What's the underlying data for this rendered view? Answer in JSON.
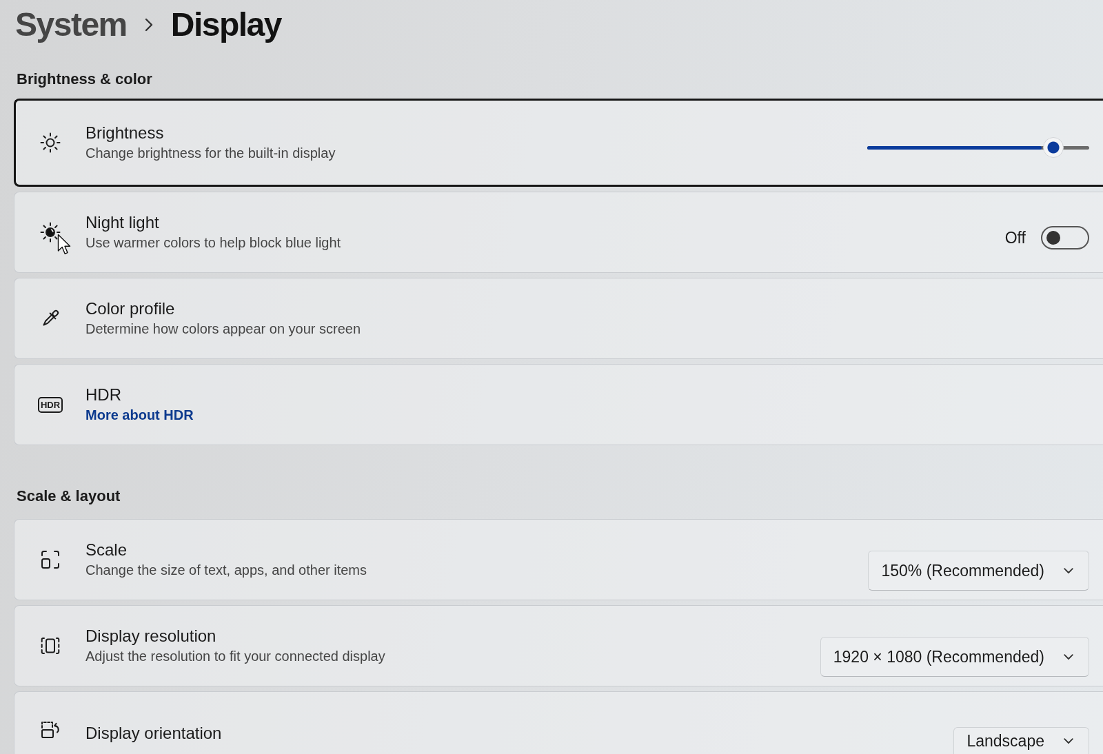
{
  "breadcrumb": [
    {
      "label": "System",
      "current": false
    },
    {
      "label": "Display",
      "current": true
    }
  ],
  "sections": [
    {
      "title": "Brightness & color",
      "items": [
        {
          "kind": "slider",
          "title": "Brightness",
          "subtitle": "Change brightness for the built-in display",
          "focused": true,
          "pointer": false,
          "level": 0.84
        },
        {
          "kind": "toggle",
          "title": "Night light",
          "subtitle": "Use warmer colors to help block blue light",
          "focused": false,
          "pointer": true,
          "on": false,
          "state_label": "Off"
        },
        {
          "kind": "plain",
          "title": "Color profile",
          "subtitle": "Determine how colors appear on your screen",
          "focused": false,
          "pointer": false
        },
        {
          "kind": "link",
          "title": "HDR",
          "icon_text": "HDR",
          "link": "More about HDR",
          "focused": false,
          "pointer": false
        }
      ]
    },
    {
      "title": "Scale & layout",
      "items": [
        {
          "kind": "dropdown",
          "title": "Scale",
          "subtitle": "Change the size of text, apps, and other items",
          "focused": false,
          "pointer": false,
          "value": "150% (Recommended)"
        },
        {
          "kind": "dropdown",
          "title": "Display resolution",
          "subtitle": "Adjust the resolution to fit your connected display",
          "focused": false,
          "pointer": false,
          "value": "1920 × 1080 (Recommended)"
        },
        {
          "kind": "dropdown",
          "title": "Display orientation",
          "focused": false,
          "pointer": false,
          "value": "Landscape"
        }
      ]
    }
  ]
}
